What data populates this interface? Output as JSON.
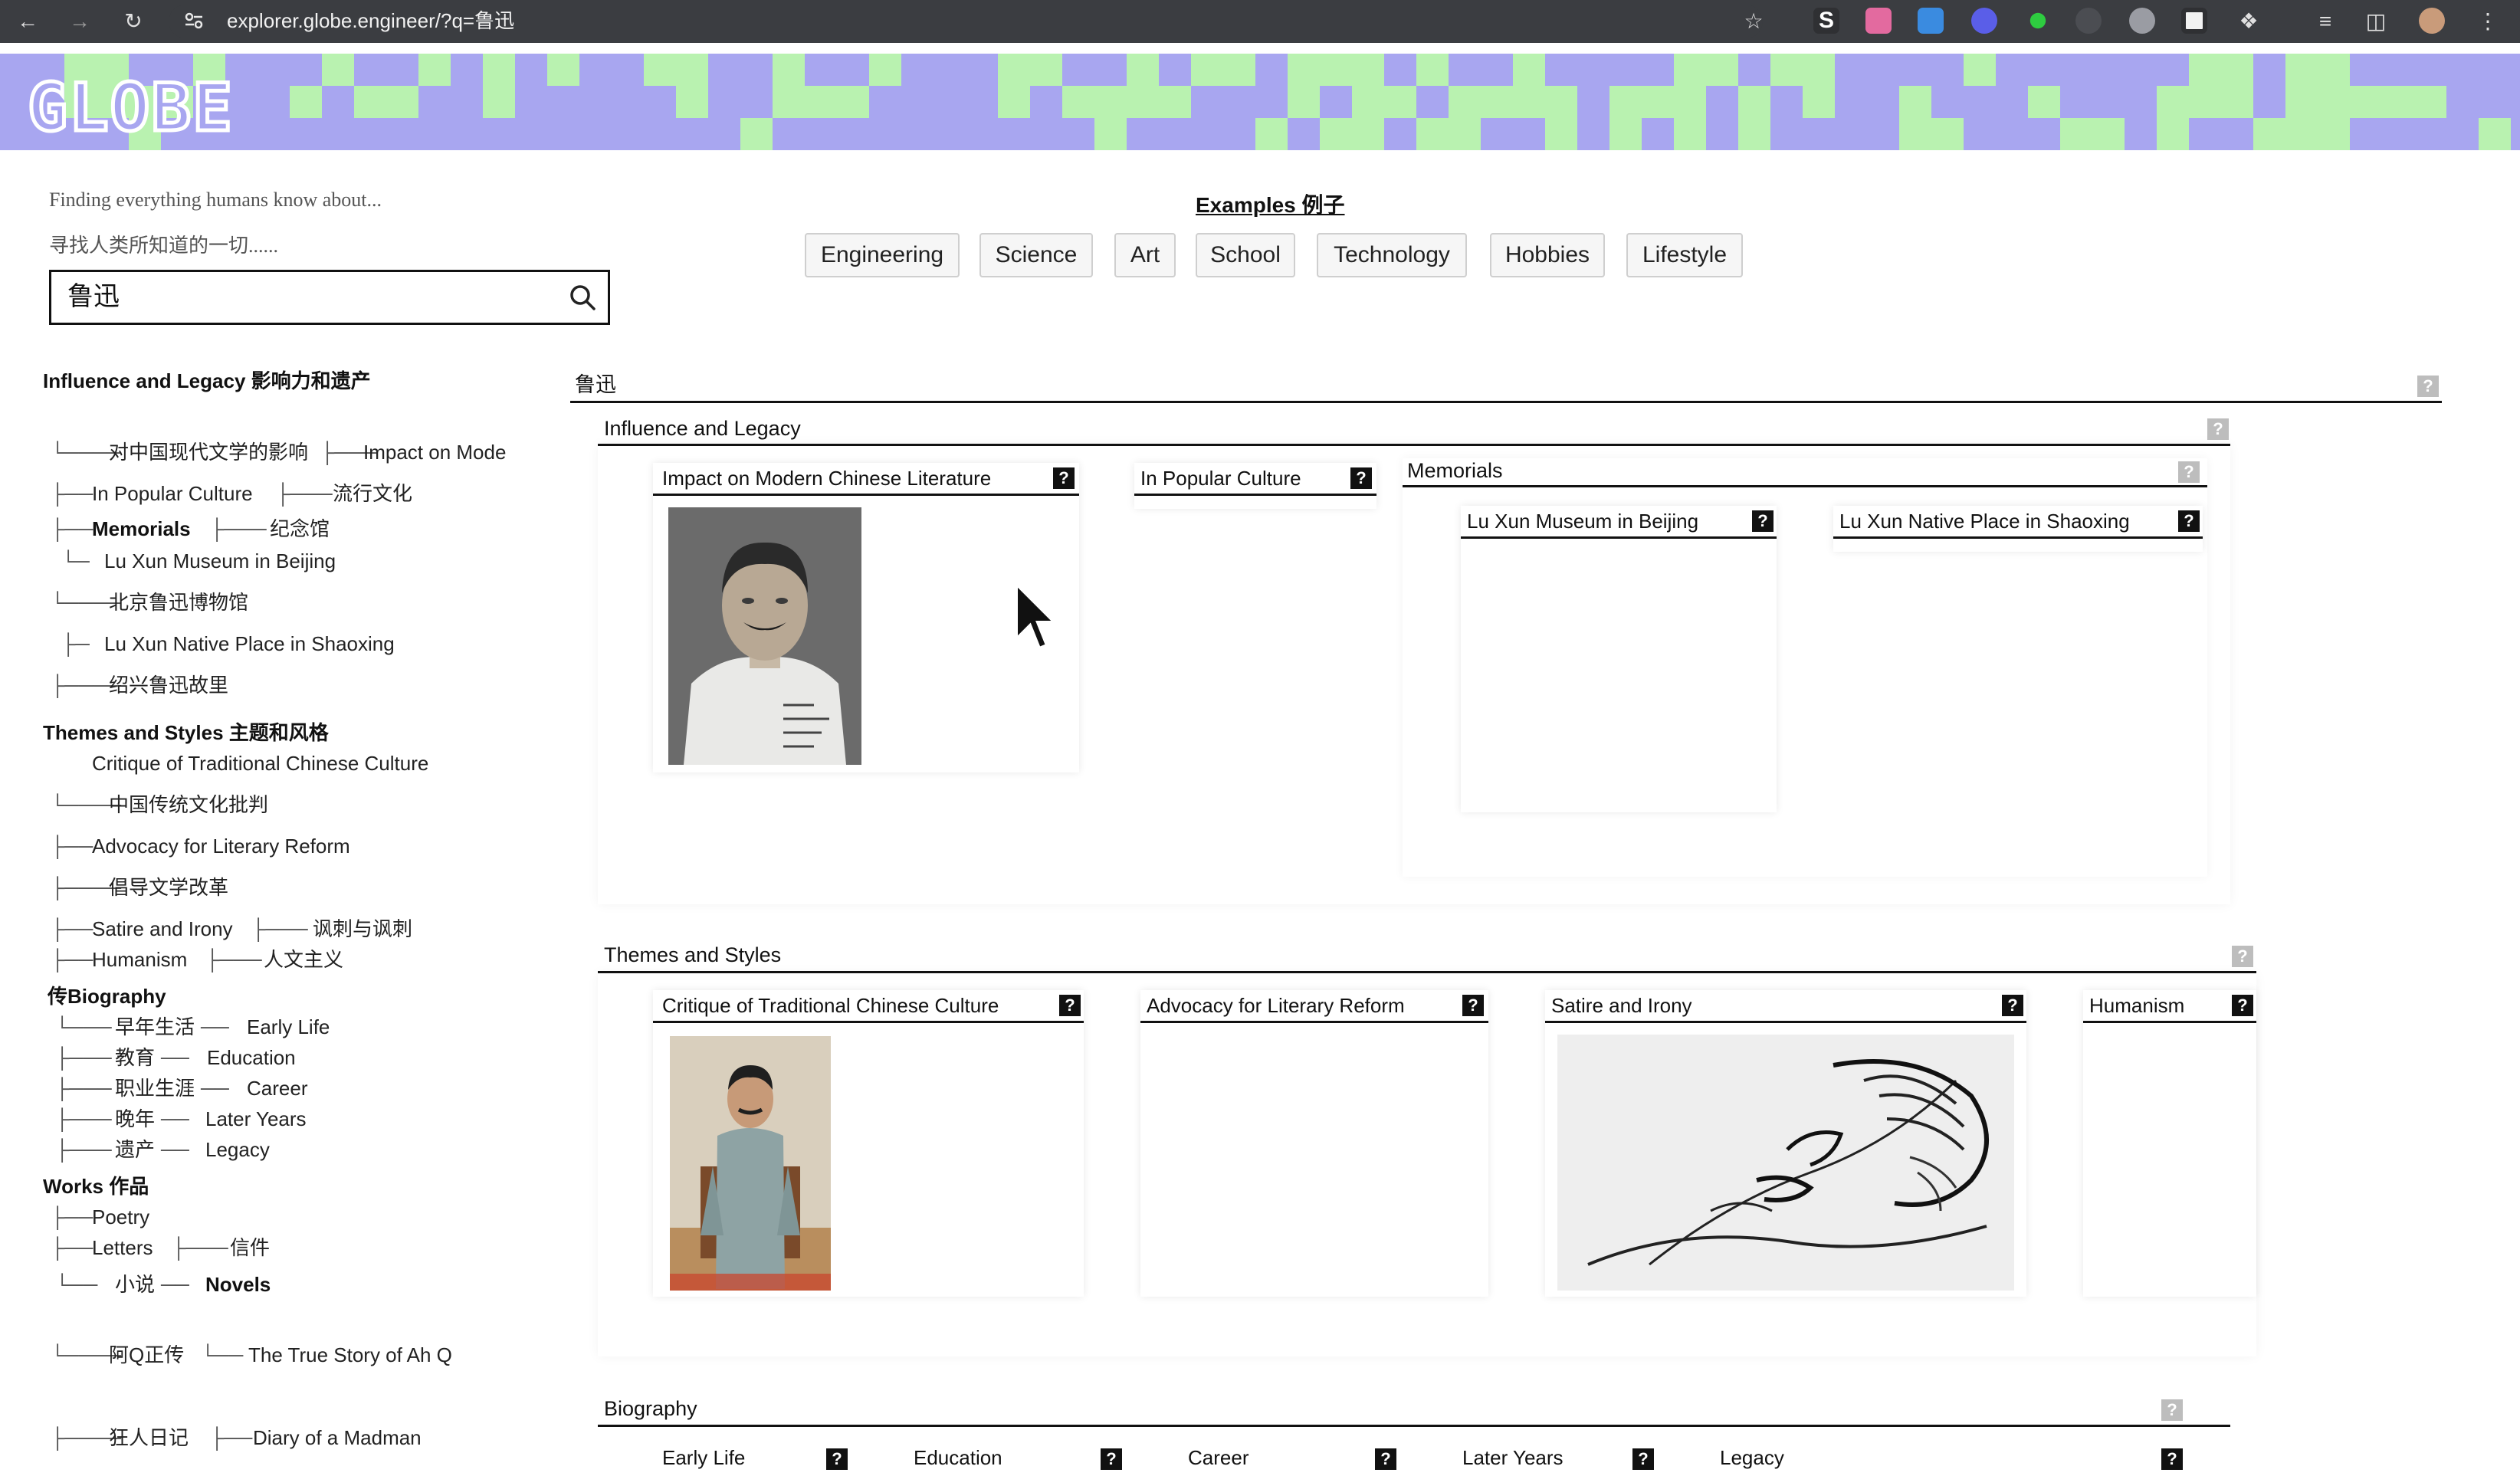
{
  "browser": {
    "url": "explorer.globe.engineer/?q=鲁迅"
  },
  "logo": "GLOBE",
  "tagline_en": "Finding everything humans know about...",
  "tagline_zh": "寻找人类所知道的一切......",
  "search": {
    "value": "鲁迅"
  },
  "examples": {
    "title": "Examples 例子",
    "items": [
      "Engineering",
      "Science",
      "Art",
      "School",
      "Technology",
      "Hobbies",
      "Lifestyle"
    ]
  },
  "sidebar": {
    "influence_heading": "Influence and Legacy 影响力和遗产",
    "i1a": "对中国现代文学的影响",
    "i1b": "Impact on Mode",
    "i2a": "In Popular Culture",
    "i2b": "流行文化",
    "i3a": "Memorials",
    "i3b": "纪念馆",
    "i4": "Lu Xun Museum in Beijing",
    "i5": "北京鲁迅博物馆",
    "i6": "Lu Xun Native Place in Shaoxing",
    "i7": "绍兴鲁迅故里",
    "themes_heading": "Themes and Styles 主题和风格",
    "t1": "Critique of Traditional Chinese Culture",
    "t2": "中国传统文化批判",
    "t3": "Advocacy for Literary Reform",
    "t4": "倡导文学改革",
    "t5a": "Satire and Irony",
    "t5b": "讽刺与讽刺",
    "t6a": "Humanism",
    "t6b": "人文主义",
    "bio_heading": "传Biography",
    "b1a": "早年生活",
    "b1b": "Early Life",
    "b2a": "教育",
    "b2b": "Education",
    "b3a": "职业生涯",
    "b3b": "Career",
    "b4a": "晚年",
    "b4b": "Later Years",
    "b5a": "遗产",
    "b5b": "Legacy",
    "works_heading": "Works 作品",
    "w1": "Poetry",
    "w2a": "Letters",
    "w2b": "信件",
    "w3a": "小说",
    "w3b": "Novels",
    "w4a": "阿Q正传",
    "w4b": "The True Story of Ah Q",
    "w5a": "狂人日记",
    "w5b": "Diary of a Madman"
  },
  "main": {
    "root_title": "鲁迅",
    "influence": {
      "title": "Influence and Legacy",
      "card1": "Impact on Modern Chinese Literature",
      "card2": "In Popular Culture",
      "memorials": "Memorials",
      "mem1": "Lu Xun Museum in Beijing",
      "mem2": "Lu Xun Native Place in Shaoxing"
    },
    "themes": {
      "title": "Themes and Styles",
      "card1": "Critique of Traditional Chinese Culture",
      "card2": "Advocacy for Literary Reform",
      "card3": "Satire and Irony",
      "card4": "Humanism"
    },
    "biography": {
      "title": "Biography",
      "card1": "Early Life",
      "card2": "Education",
      "card3": "Career",
      "card4": "Later Years",
      "card5": "Legacy"
    },
    "help_glyph": "?"
  },
  "colors": {
    "banner_purple": "#a8a6f0",
    "banner_green": "#b9f2b0",
    "chrome": "#3b3d41"
  }
}
